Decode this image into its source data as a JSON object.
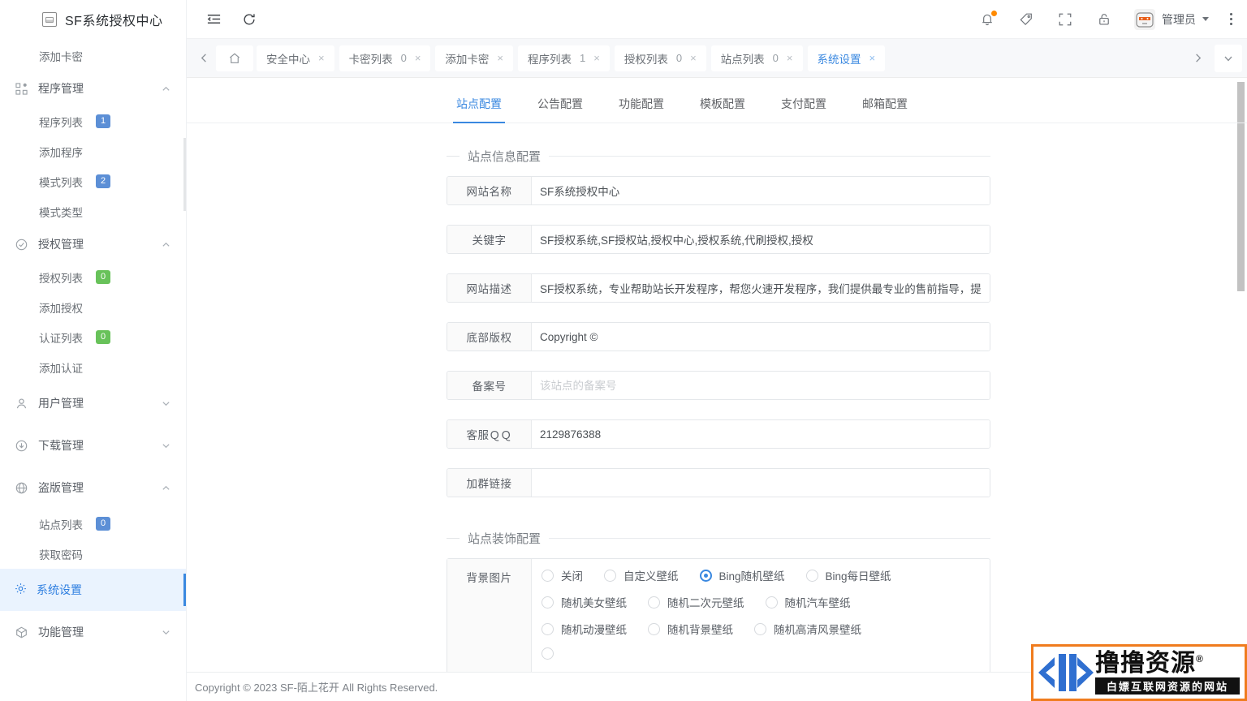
{
  "app": {
    "logo_text": "SF系统授权中心",
    "footer": "Copyright © 2023 SF-陌上花开 All Rights Reserved."
  },
  "sidebar": {
    "first_item": {
      "label": "添加卡密"
    },
    "groups": [
      {
        "label": "程序管理",
        "icon": "grid-icon",
        "expanded": true,
        "caret": "chevron-up-icon",
        "items": [
          {
            "label": "程序列表",
            "badge": "1",
            "badge_color": "#5c8fd6"
          },
          {
            "label": "添加程序",
            "badge": "",
            "badge_color": ""
          },
          {
            "label": "模式列表",
            "badge": "2",
            "badge_color": "#5c8fd6"
          },
          {
            "label": "模式类型",
            "badge": "",
            "badge_color": ""
          }
        ]
      },
      {
        "label": "授权管理",
        "icon": "check-circle-icon",
        "expanded": true,
        "caret": "chevron-up-icon",
        "items": [
          {
            "label": "授权列表",
            "badge": "0",
            "badge_color": "#68c25a"
          },
          {
            "label": "添加授权",
            "badge": "",
            "badge_color": ""
          },
          {
            "label": "认证列表",
            "badge": "0",
            "badge_color": "#68c25a"
          },
          {
            "label": "添加认证",
            "badge": "",
            "badge_color": ""
          }
        ]
      },
      {
        "label": "用户管理",
        "icon": "user-icon",
        "expanded": false,
        "caret": "chevron-down-icon",
        "items": []
      },
      {
        "label": "下载管理",
        "icon": "download-icon",
        "expanded": false,
        "caret": "chevron-down-icon",
        "items": []
      },
      {
        "label": "盗版管理",
        "icon": "globe-icon",
        "expanded": true,
        "caret": "chevron-up-icon",
        "items": [
          {
            "label": "站点列表",
            "badge": "0",
            "badge_color": "#5c8fd6"
          },
          {
            "label": "获取密码",
            "badge": "",
            "badge_color": ""
          }
        ]
      }
    ],
    "active_item": {
      "label": "系统设置",
      "icon": "gear-icon"
    },
    "last_group": {
      "label": "功能管理",
      "icon": "cube-icon",
      "caret": "chevron-down-icon"
    }
  },
  "topbar": {
    "menu_toggle": "menu-fold-icon",
    "refresh": "refresh-icon",
    "notification": "bell-icon",
    "tag": "tag-icon",
    "fullscreen": "fullscreen-icon",
    "lock": "lock-icon",
    "user_name": "管理员",
    "more": "kebab-icon"
  },
  "tabbar": {
    "prev": "chevron-left-icon",
    "home": "home-icon",
    "next": "chevron-right-icon",
    "dropdown": "chevron-down-icon",
    "tabs": [
      {
        "label": "安全中心",
        "count": "",
        "active": false
      },
      {
        "label": "卡密列表",
        "count": "0",
        "active": false
      },
      {
        "label": "添加卡密",
        "count": "",
        "active": false
      },
      {
        "label": "程序列表",
        "count": "1",
        "active": false
      },
      {
        "label": "授权列表",
        "count": "0",
        "active": false
      },
      {
        "label": "站点列表",
        "count": "0",
        "active": false
      },
      {
        "label": "系统设置",
        "count": "",
        "active": true
      }
    ],
    "close_glyph": "×"
  },
  "main": {
    "tabs": [
      {
        "label": "站点配置",
        "active": true
      },
      {
        "label": "公告配置",
        "active": false
      },
      {
        "label": "功能配置",
        "active": false
      },
      {
        "label": "模板配置",
        "active": false
      },
      {
        "label": "支付配置",
        "active": false
      },
      {
        "label": "邮箱配置",
        "active": false
      }
    ],
    "section_site_info": "站点信息配置",
    "fields": [
      {
        "label": "网站名称",
        "value": "SF系统授权中心",
        "placeholder": ""
      },
      {
        "label": "关键字",
        "value": "SF授权系统,SF授权站,授权中心,授权系统,代刷授权,授权",
        "placeholder": ""
      },
      {
        "label": "网站描述",
        "value": "SF授权系统，专业帮助站长开发程序，帮您火速开发程序，我们提供最专业的售前指导，提",
        "placeholder": ""
      },
      {
        "label": "底部版权",
        "value": "Copyright ©",
        "placeholder": ""
      },
      {
        "label": "备案号",
        "value": "",
        "placeholder": "该站点的备案号"
      },
      {
        "label": "客服ＱＱ",
        "value": "2129876388",
        "placeholder": ""
      },
      {
        "label": "加群链接",
        "value": "",
        "placeholder": ""
      }
    ],
    "section_site_decor": "站点装饰配置",
    "bg_field_label": "背景图片",
    "bg_options": [
      [
        {
          "label": "关闭",
          "checked": false
        },
        {
          "label": "自定义壁纸",
          "checked": false
        },
        {
          "label": "Bing随机壁纸",
          "checked": true
        },
        {
          "label": "Bing每日壁纸",
          "checked": false
        }
      ],
      [
        {
          "label": "随机美女壁纸",
          "checked": false
        },
        {
          "label": "随机二次元壁纸",
          "checked": false
        },
        {
          "label": "随机汽车壁纸",
          "checked": false
        }
      ],
      [
        {
          "label": "随机动漫壁纸",
          "checked": false
        },
        {
          "label": "随机背景壁纸",
          "checked": false
        },
        {
          "label": "随机高清风景壁纸",
          "checked": false
        }
      ]
    ]
  },
  "watermark": {
    "main_text": "撸撸资源",
    "registered": "®",
    "sub_text": "白嫖互联网资源的网站",
    "border_color": "#f07c1e",
    "logo_color": "#2f6fd0"
  }
}
